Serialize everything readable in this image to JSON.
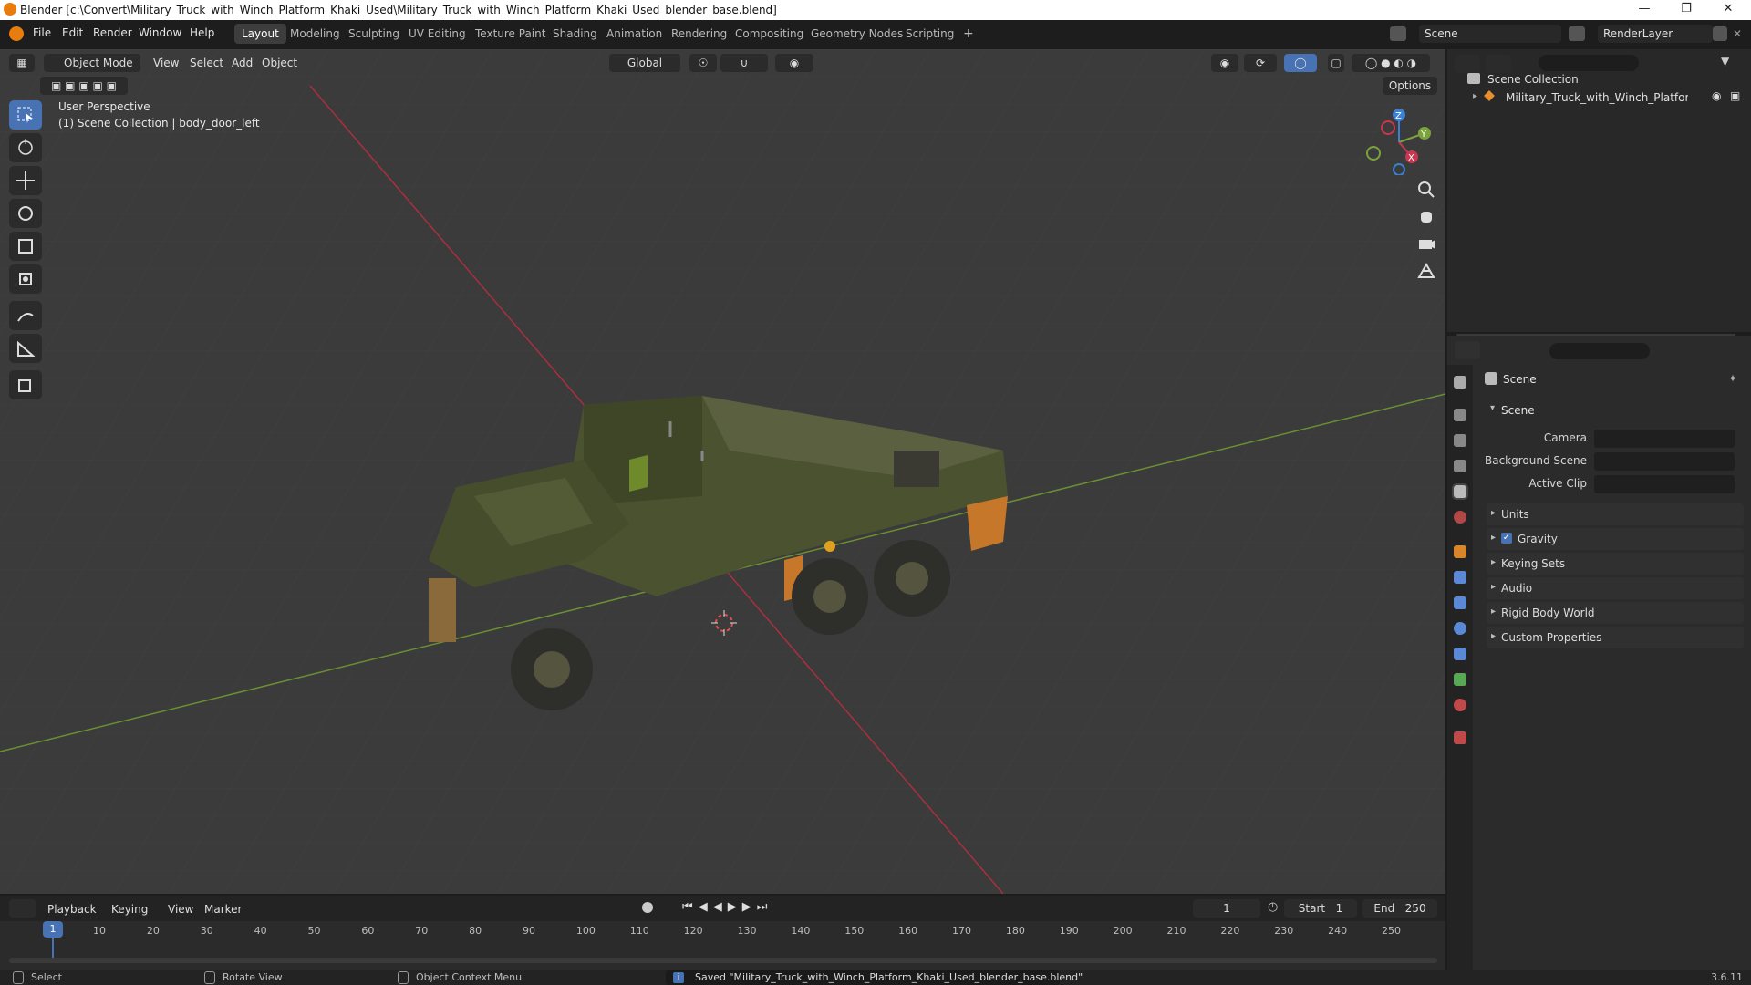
{
  "window": {
    "title": "Blender [c:\\Convert\\Military_Truck_with_Winch_Platform_Khaki_Used\\Military_Truck_with_Winch_Platform_Khaki_Used_blender_base.blend]"
  },
  "menus": [
    "File",
    "Edit",
    "Render",
    "Window",
    "Help"
  ],
  "workspaces": [
    "Layout",
    "Modeling",
    "Sculpting",
    "UV Editing",
    "Texture Paint",
    "Shading",
    "Animation",
    "Rendering",
    "Compositing",
    "Geometry Nodes",
    "Scripting"
  ],
  "active_workspace": "Layout",
  "scene_field": "Scene",
  "renderlayer_field": "RenderLayer",
  "viewport": {
    "mode": "Object Mode",
    "menu": [
      "View",
      "Select",
      "Add",
      "Object"
    ],
    "orientation": "Global",
    "options_label": "Options",
    "overlay_line1": "User Perspective",
    "overlay_line2": "(1) Scene Collection | body_door_left",
    "gizmo_axes": [
      "Z",
      "Y",
      "X"
    ]
  },
  "outliner": {
    "root": "Scene Collection",
    "item": "Military_Truck_with_Winch_Platform_Kh"
  },
  "properties": {
    "header": "Scene",
    "section": "Scene",
    "fields": [
      {
        "label": "Camera"
      },
      {
        "label": "Background Scene"
      },
      {
        "label": "Active Clip"
      }
    ],
    "panels": [
      "Units",
      "Gravity",
      "Keying Sets",
      "Audio",
      "Rigid Body World",
      "Custom Properties"
    ],
    "gravity_checked": true
  },
  "timeline": {
    "menu": [
      "Playback",
      "Keying",
      "View",
      "Marker"
    ],
    "current_frame": "1",
    "start_label": "Start",
    "start": "1",
    "end_label": "End",
    "end": "250",
    "ticks": [
      "1",
      "10",
      "20",
      "30",
      "40",
      "50",
      "60",
      "70",
      "80",
      "90",
      "100",
      "110",
      "120",
      "130",
      "140",
      "150",
      "160",
      "170",
      "180",
      "190",
      "200",
      "210",
      "220",
      "230",
      "240",
      "250"
    ]
  },
  "status": {
    "select": "Select",
    "rotate": "Rotate View",
    "context": "Object Context Menu",
    "message": "Saved \"Military_Truck_with_Winch_Platform_Khaki_Used_blender_base.blend\"",
    "version": "3.6.11"
  },
  "colors": {
    "accent": "#4772b3",
    "x_axis": "#c7374f",
    "y_axis": "#7aa33c",
    "z_axis": "#3d7fd1",
    "truck_body": "#4b5230"
  }
}
